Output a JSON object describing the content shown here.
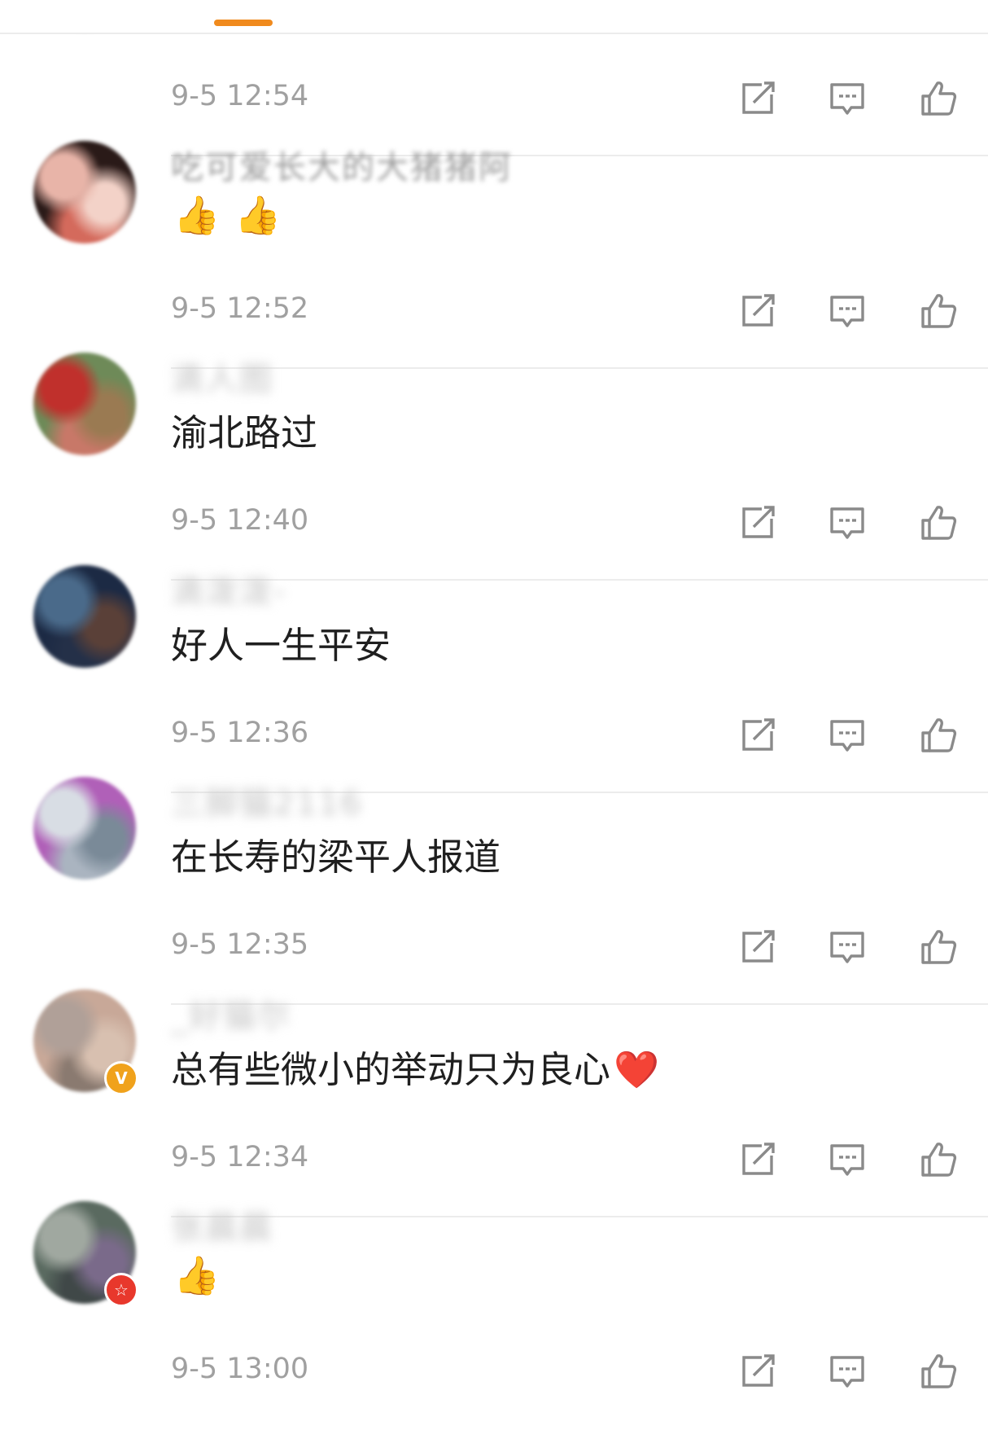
{
  "comments": [
    {
      "username": "",
      "text": "",
      "emoji": "👍👍👍",
      "time": "9-5 12:54",
      "avatar_colors": [
        "#5a7040",
        "#c8a0c8",
        "#e8d8ea",
        "#3e5a30"
      ],
      "badge": null
    },
    {
      "username": "吃可爱长大的大猪猪阿",
      "text": "",
      "emoji": "👍👍",
      "time": "9-5 12:52",
      "avatar_colors": [
        "#2a1a18",
        "#e8b4a8",
        "#f3d2c8",
        "#d46a5c"
      ],
      "badge": null
    },
    {
      "username": "滴人图",
      "text": "渝北路过",
      "emoji": "",
      "time": "9-5 12:40",
      "avatar_colors": [
        "#6e8a58",
        "#c0302c",
        "#9a7a52",
        "#c87868"
      ],
      "badge": null
    },
    {
      "username": "滴泼泼-",
      "text": "好人一生平安",
      "emoji": "",
      "time": "9-5 12:36",
      "avatar_colors": [
        "#1c2a44",
        "#4a6a8a",
        "#5a4038",
        "#243048"
      ],
      "badge": null
    },
    {
      "username": "三脚猫2116",
      "text": "在长寿的梁平人报道",
      "emoji": "",
      "time": "9-5 12:35",
      "avatar_colors": [
        "#b060b8",
        "#d8dde4",
        "#7a8a98",
        "#aab4c0"
      ],
      "badge": null
    },
    {
      "username": "_好猫尔",
      "text": "总有些微小的举动只为良心",
      "emoji": "❤️",
      "time": "9-5 12:34",
      "avatar_colors": [
        "#c8a898",
        "#b0a098",
        "#d8c0b0",
        "#8a7a70"
      ],
      "badge": {
        "type": "verified",
        "symbol": "V",
        "color": "#f0a21c"
      }
    },
    {
      "username": "张晨晨",
      "text": "",
      "emoji": "👍",
      "time": "9-5 13:00",
      "avatar_colors": [
        "#5a6a60",
        "#a0a8a0",
        "#7a6a8a",
        "#404848"
      ],
      "badge": {
        "type": "star",
        "symbol": "☆",
        "color": "#e8382c"
      }
    }
  ],
  "icons": {
    "repost": "repost-icon",
    "comment": "comment-icon",
    "like": "like-icon"
  },
  "colors": {
    "accent": "#f08a1d",
    "time_text": "#a0a0a0",
    "icon_stroke": "#8a8a8a"
  }
}
